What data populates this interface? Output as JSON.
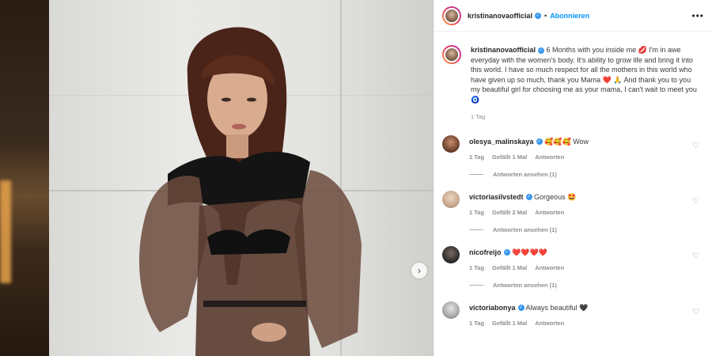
{
  "post": {
    "username": "kristinanovaofficial",
    "follow_label": "Abonnieren",
    "more_icon": "more-horizontal-icon",
    "next_icon": "chevron-right-icon"
  },
  "caption": {
    "username": "kristinanovaofficial",
    "text": "6 Months with you inside me 💋 I'm in awe everyday with the women's body. It's ability to grow life and bring it into this world. I have so much respect for all the mothers in this world who have given up so much, thank you Mama ❤️ 🙏 And thank you to you my beautiful girl for choosing me as your mama, I can't wait to meet you 🧿",
    "time": "1 Tag"
  },
  "comments": [
    {
      "username": "olesya_malinskaya",
      "verified": true,
      "text": "🥰🥰🥰 Wow",
      "time": "1 Tag",
      "likes": "Gefällt 1 Mal",
      "reply": "Antworten",
      "view_replies": "Antworten ansehen (1)",
      "avatar_color": "#6a3f2c"
    },
    {
      "username": "victoriasilvstedt",
      "verified": true,
      "text": "Gorgeous 🤩",
      "time": "1 Tag",
      "likes": "Gefällt 2 Mal",
      "reply": "Antworten",
      "view_replies": "Antworten ansehen (1)",
      "avatar_color": "#c9a98e"
    },
    {
      "username": "nicofreijo",
      "verified": true,
      "text": "❤️❤️❤️❤️",
      "time": "1 Tag",
      "likes": "Gefällt 1 Mal",
      "reply": "Antworten",
      "view_replies": "Antworten ansehen (1)",
      "avatar_color": "#2b2b2b"
    },
    {
      "username": "victoriabonya",
      "verified": true,
      "text": "Always beautiful 🖤",
      "time": "1 Tag",
      "likes": "Gefällt 1 Mal",
      "reply": "Antworten",
      "view_replies": "",
      "avatar_color": "#a7a7a7"
    }
  ],
  "colors": {
    "link_blue": "#0095f6",
    "verified_blue": "#3897f0",
    "muted": "#8e8e8e"
  }
}
